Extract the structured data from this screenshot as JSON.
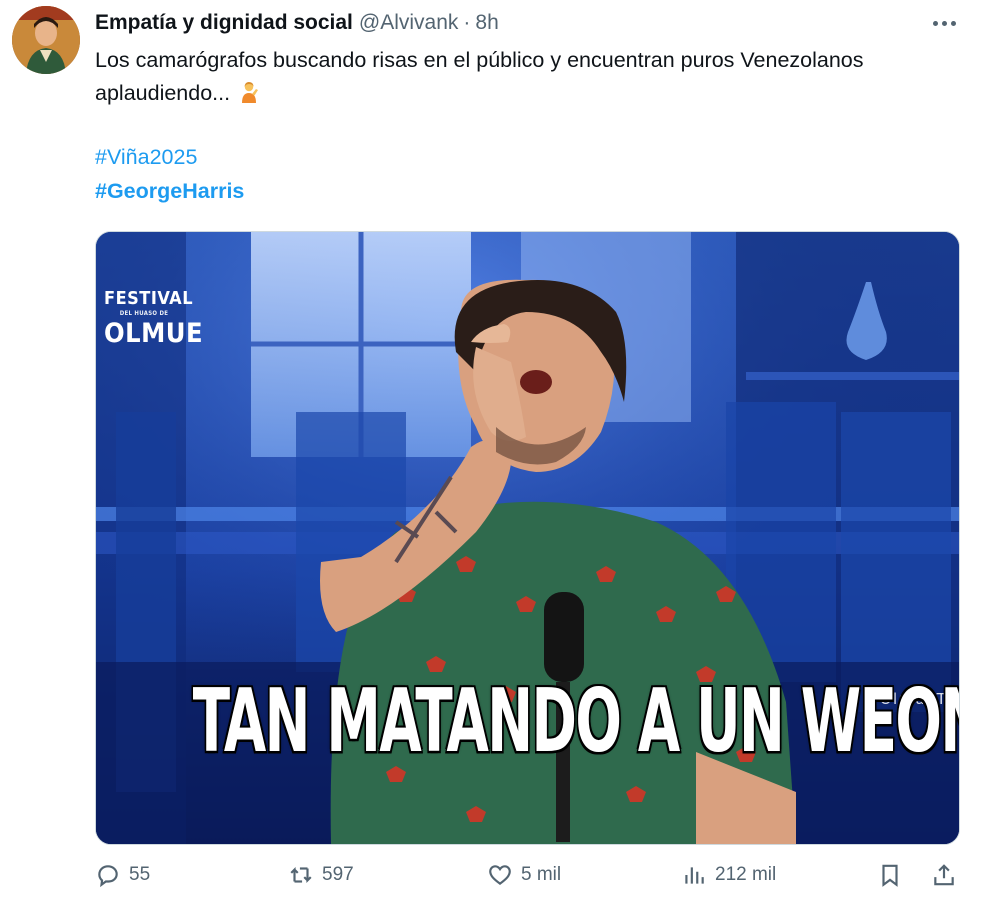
{
  "author": {
    "display_name": "Empatía y dignidad social",
    "handle": "@Alvivank",
    "separator": "·",
    "time": "8h"
  },
  "tweet": {
    "text": "Los camarógrafos buscando risas en el público y encuentran puros Venezolanos aplaudiendo...",
    "emoji_icon": "person-gesturing-emoji",
    "hashtags": [
      "#Viña2025",
      "#GeorgeHarris"
    ]
  },
  "media": {
    "logo_line1": "FESTIVAL",
    "logo_line2": "DEL HUASO DE",
    "logo_line3": "OLMUE",
    "watermark": "@OlmueTV",
    "caption": "TAN MATANDO A UN WEON !"
  },
  "actions": {
    "reply_count": "55",
    "retweet_count": "597",
    "like_count": "5 mil",
    "views_count": "212 mil"
  },
  "colors": {
    "link": "#1d9bf0",
    "secondary_text": "#536471",
    "primary_text": "#0f1419"
  }
}
